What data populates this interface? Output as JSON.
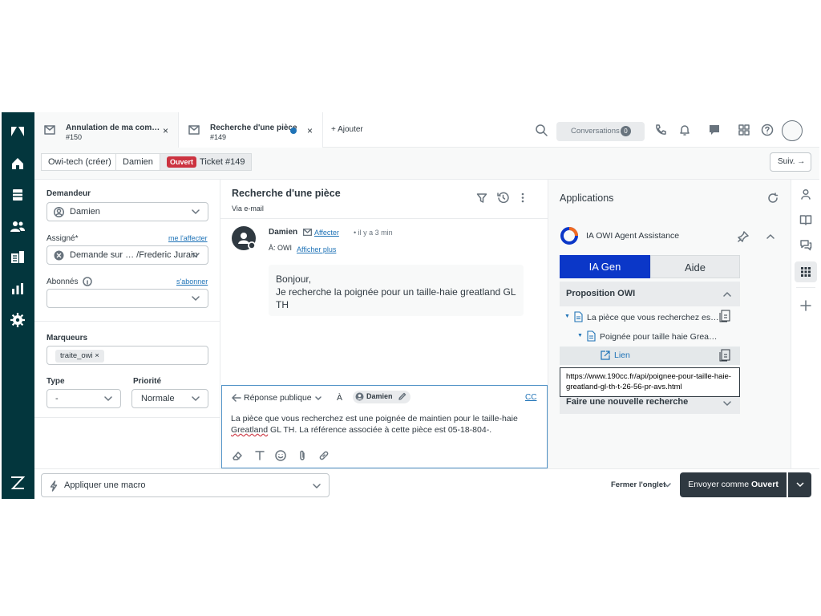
{
  "tabs": [
    {
      "title": "Annulation de ma com…",
      "number": "#150",
      "close": "×"
    },
    {
      "title": "Recherche d'une pièce",
      "number": "#149",
      "close": "×"
    }
  ],
  "topbar": {
    "add_tab": "+ Ajouter",
    "conversations_label": "Conversations",
    "conversations_count": "0"
  },
  "breadcrumb": {
    "org": "Owi-tech (créer)",
    "user": "Damien",
    "status": "Ouvert",
    "ticket": "Ticket #149",
    "next": "Suiv. →"
  },
  "left": {
    "requester_label": "Demandeur",
    "requester_value": "Damien",
    "assignee_label": "Assigné*",
    "assign_me": "me l'affecter",
    "assignee_value": "Demande sur … /Frederic Jurain",
    "followers_label": "Abonnés",
    "subscribe": "s'abonner",
    "tags_label": "Marqueurs",
    "tag": "traite_owi ×",
    "type_label": "Type",
    "type_value": "-",
    "priority_label": "Priorité",
    "priority_value": "Normale"
  },
  "conversation": {
    "subject": "Recherche d'une pièce",
    "via": "Via e-mail",
    "sender": "Damien",
    "assign_link": "Affecter",
    "time": "• il y a 3 min",
    "to_label": "À: OWI",
    "show_more": "Afficher plus",
    "message_line1": "Bonjour,",
    "message_line2": "Je recherche la poignée pour un taille-haie greatland GL TH"
  },
  "reply": {
    "type": "Réponse publique",
    "to_label": "À",
    "recipient": "Damien",
    "cc": "CC",
    "text_part1": "La pièce que vous recherchez est une poignée de maintien pour le taille-haie ",
    "text_misspelled": "Greatland",
    "text_part2": " GL TH. La référence associée à cette pièce est 05-18-804-."
  },
  "apps": {
    "title": "Applications",
    "app_name": "IA OWI Agent Assistance",
    "tab_active": "IA Gen",
    "tab_other": "Aide",
    "proposal_header": "Proposition OWI",
    "tree_item1": "La pièce que vous recherchez es…",
    "tree_item2": "Poignée pour taille haie Grea…",
    "link_label": "Lien",
    "tooltip_url": "https://www.190cc.fr/api/poignee-pour-taille-haie-greatland-gl-th-t-26-56-pr-avs.html",
    "new_search": "Faire une nouvelle recherche"
  },
  "footer": {
    "macro": "Appliquer une macro",
    "close_tab": "Fermer l'onglet",
    "send_prefix": "Envoyer comme ",
    "send_status": "Ouvert"
  },
  "colors": {
    "nav": "#03363d",
    "accent": "#1f73b7",
    "open_badge": "#cc3340",
    "ia_gen": "#0b37c8"
  }
}
